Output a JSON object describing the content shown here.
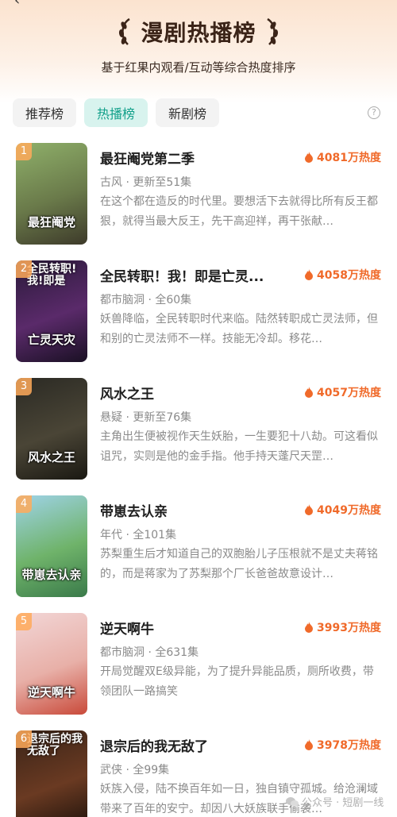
{
  "header": {
    "back_icon": "back-arrow-icon",
    "title": "漫剧热播榜",
    "subtitle": "基于红果内观看/互动等综合热度排序"
  },
  "tabs": [
    {
      "label": "推荐榜",
      "active": false
    },
    {
      "label": "热播榜",
      "active": true
    },
    {
      "label": "新剧榜",
      "active": false
    }
  ],
  "help_icon": "question-icon",
  "accent_color": "#11a08a",
  "heat_color": "#f06a2a",
  "items": [
    {
      "rank": "1",
      "title": "最狂阉党第二季",
      "heat": "4081万热度",
      "meta": "古风 · 更新至51集",
      "desc": "在这个都在造反的时代里。要想活下去就得比所有反王都狠，就得当最大反王，先干高迎祥，再干张献…",
      "cover_text": "最狂阉党",
      "cover_top": "",
      "cover_colors": [
        "#8fb06a",
        "#6a7a4a",
        "#3d3a2a"
      ]
    },
    {
      "rank": "2",
      "title": "全民转职！我！即是亡灵...",
      "heat": "4058万热度",
      "meta": "都市脑洞 · 全60集",
      "desc": "妖兽降临，全民转职时代来临。陆然转职成亡灵法师，但和别的亡灵法师不一样。技能无冷却。移花…",
      "cover_text": "亡灵天灾",
      "cover_top": "全民转职!我!即是",
      "cover_colors": [
        "#2a1a3a",
        "#5a2a6a",
        "#1a1024"
      ]
    },
    {
      "rank": "3",
      "title": "风水之王",
      "heat": "4057万热度",
      "meta": "悬疑 · 更新至76集",
      "desc": "主角出生便被视作天生妖胎，一生要犯十八劫。可这看似诅咒，实则是他的金手指。他手持天蓬尺天罡…",
      "cover_text": "风水之王",
      "cover_top": "",
      "cover_colors": [
        "#2b2a24",
        "#4a4536",
        "#1a1812"
      ]
    },
    {
      "rank": "4",
      "title": "带崽去认亲",
      "heat": "4049万热度",
      "meta": "年代 · 全101集",
      "desc": "苏梨重生后才知道自己的双胞胎儿子压根就不是丈夫蒋铭的，而是蒋家为了苏梨那个厂长爸爸故意设计…",
      "cover_text": "带崽去认亲",
      "cover_top": "",
      "cover_colors": [
        "#9fd3e8",
        "#6fb36a",
        "#3a7a4a"
      ]
    },
    {
      "rank": "5",
      "title": "逆天啊牛",
      "heat": "3993万热度",
      "meta": "都市脑洞 · 全631集",
      "desc": "开局觉醒双E级异能，为了提升异能品质，厕所收费，带领团队一路搞笑",
      "cover_text": "逆天啊牛",
      "cover_top": "",
      "cover_colors": [
        "#f2d6d6",
        "#e8b0a8",
        "#c94a3a"
      ]
    },
    {
      "rank": "6",
      "title": "退宗后的我无敌了",
      "heat": "3978万热度",
      "meta": "武侠 · 全99集",
      "desc": "妖族入侵，陆不换百年如一日，独自镇守孤城。给沧澜域带来了百年的安宁。却因八大妖族联手偷袭…",
      "cover_text": "",
      "cover_top": "退宗后的我无敌了",
      "cover_colors": [
        "#3a2418",
        "#6a3a22",
        "#1a100a"
      ]
    }
  ],
  "watermark": "公众号 · 短剧一线"
}
